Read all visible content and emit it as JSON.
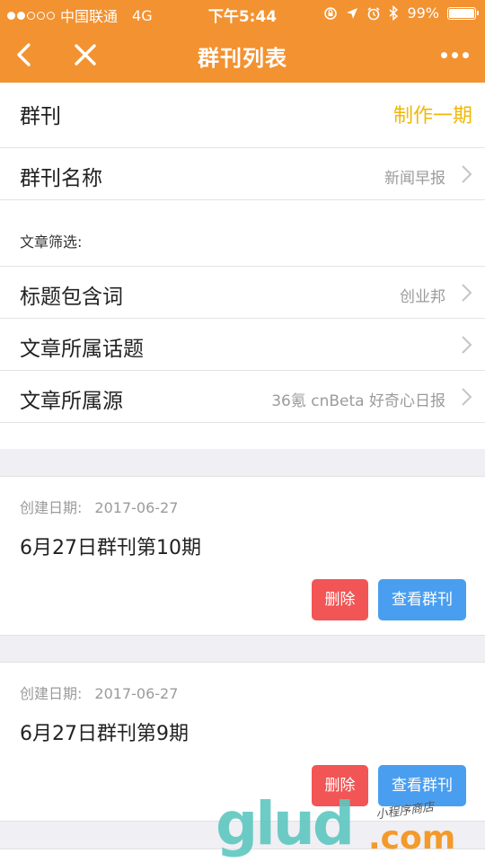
{
  "status_bar": {
    "carrier": "中国联通",
    "network": "4G",
    "time": "下午5:44",
    "battery_text": "99%",
    "battery_level": 0.99,
    "signal_filled": 2,
    "signal_total": 5
  },
  "nav": {
    "title": "群刊列表",
    "back_icon": "chevron-left-icon",
    "close_icon": "close-icon",
    "more_icon": "more-dots-icon"
  },
  "settings": {
    "header_label": "群刊",
    "header_action": "制作一期",
    "name_label": "群刊名称",
    "name_value": "新闻早报",
    "filter_caption": "文章筛选:",
    "title_keyword_label": "标题包含词",
    "title_keyword_value": "创业邦",
    "topic_label": "文章所属话题",
    "topic_value": "",
    "source_label": "文章所属源",
    "source_value": "36氪 cnBeta 好奇心日报"
  },
  "issues": [
    {
      "date_label": "创建日期:",
      "date_value": "2017-06-27",
      "title": "6月27日群刊第10期",
      "delete_label": "删除",
      "view_label": "查看群刊"
    },
    {
      "date_label": "创建日期:",
      "date_value": "2017-06-27",
      "title": "6月27日群刊第9期",
      "delete_label": "删除",
      "view_label": "查看群刊"
    }
  ],
  "watermark": {
    "logo_text": "glud",
    "suffix": ".com",
    "tagline": "小程序商店"
  },
  "colors": {
    "nav_bg": "#f39231",
    "accent_yellow": "#f2b705",
    "delete_red": "#f25555",
    "view_blue": "#4a9ef0",
    "page_bg": "#efeff4"
  }
}
